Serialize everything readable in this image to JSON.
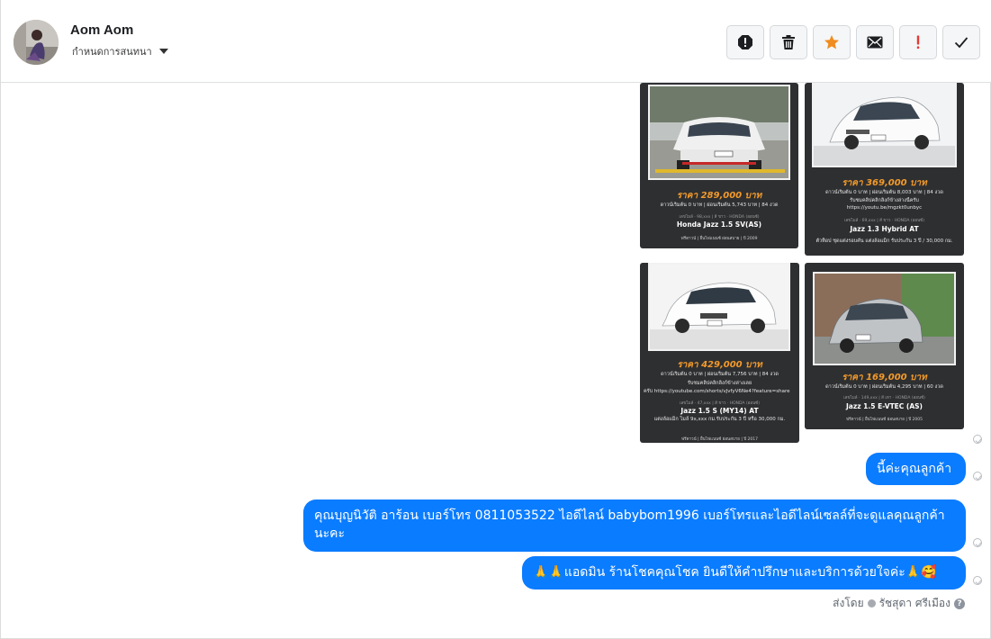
{
  "contact": {
    "name": "Aom Aom",
    "status": "กำหนดการสนทนา"
  },
  "actions": [
    {
      "name": "alert-icon"
    },
    {
      "name": "trash-icon"
    },
    {
      "name": "star-icon",
      "color": "#f08c20"
    },
    {
      "name": "envelope-icon"
    },
    {
      "name": "exclamation-icon",
      "color": "#e53935"
    },
    {
      "name": "check-icon"
    }
  ],
  "cards": [
    {
      "price": "ราคา 289,000 บาท",
      "finance": "ดาวน์เริ่มต้น 0 บาท | ผ่อนเริ่มต้น 5,743 บาท | 84 งวด",
      "tags": "เลขไมล์ · 98,xxx | สี ขาว · HONDA (ออนซ์)",
      "model": "Honda Jazz 1.5 SV(AS)",
      "foot": "ฟรีดาวน์ | ยื่นไฟแนนซ์ ผ่อนสบาย | ปี 2009"
    },
    {
      "price": "ราคา 369,000 บาท",
      "finance": "ดาวน์เริ่มต้น 0 บาท | ผ่อนเริ่มต้น 8,003 บาท | 84 งวด",
      "extra1": "รับชมคลิปคลิกลิงก์ข้างล่างนี้ครับ",
      "link": "https://youtu.be/mgzkt0unbyc",
      "tags": "เลขไมล์ · 69,xxx | สี ขาว · HONDA (ออนซ์)",
      "model": "Jazz 1.3 Hybrid AT",
      "note": "ตัวท็อป ชุดแต่งรอบคัน แต่งล้อแม็ก รับประกัน 3 ปี / 30,000 กม.",
      "foot": ""
    },
    {
      "price": "ราคา 429,000 บาท",
      "finance": "ดาวน์เริ่มต้น 0 บาท | ผ่อนเริ่มต้น 7,756 บาท | 84 งวด",
      "extra1": "รับชมคลิปคลิกลิงก์ข้างล่างเลย",
      "link": "ครับ https://youtube.com/shorts/vJvfyV6Ne4?feature=share",
      "tags": "เลขไมล์ · 47,xxx | สี ขาว · HONDA (ออนซ์)",
      "model": "Jazz 1.5 S (MY14) AT",
      "note": "แต่งล้อแม็ก ไมล์ 9x,xxx กม.รับประกัน 3 ปี หรือ 30,000 กม.",
      "foot": "ฟรีดาวน์ | ยื่นไฟแนนซ์ ผ่อนสบาย | ปี 2017"
    },
    {
      "price": "ราคา 169,000 บาท",
      "finance": "ดาวน์เริ่มต้น 0 บาท | ผ่อนเริ่มต้น 4,295 บาท | 60 งวด",
      "tags": "เลขไมล์ · 149,xxx | สี เทา · HONDA (ออนซ์)",
      "model": "Jazz 1.5 E-VTEC (AS)",
      "foot": "ฟรีดาวน์ | ยื่นไฟแนนซ์ ผ่อนสบาย | ปี 2005"
    }
  ],
  "messages": [
    {
      "text": "นี้ค่ะคุณลูกค้า"
    },
    {
      "text": "คุณบุญนิวัติ  อาร้อน        เบอร์โทร 0811053522  ไอดีไลน์ babybom1996   เบอร์โทรและไอดีไลน์เซลล์ที่จะดูแลคุณลูกค้านะคะ"
    },
    {
      "text": "🙏🙏แอดมิน ร้านโชคคุณโชค ยินดีให้คำปรึกษาและบริการด้วยใจค่ะ🙏🥰"
    }
  ],
  "sent_by": {
    "prefix": "ส่งโดย",
    "agent": "รัชสุดา ศรีเมือง"
  }
}
